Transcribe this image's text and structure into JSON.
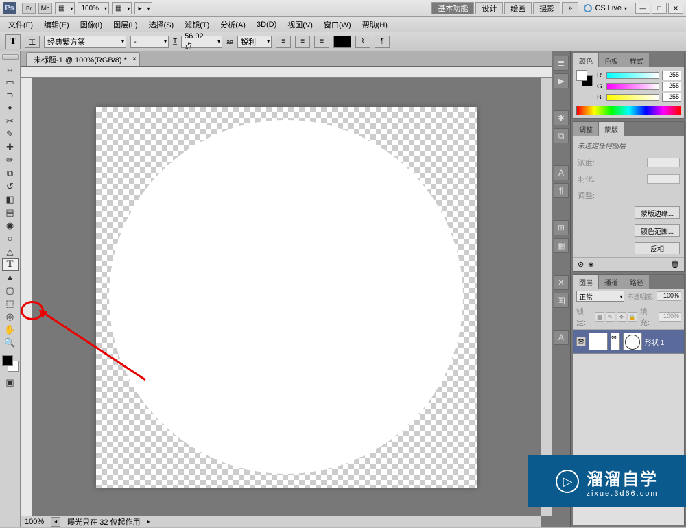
{
  "title_bar": {
    "zoom_dropdown": "100%",
    "workspaces": [
      "基本功能",
      "设计",
      "绘画",
      "摄影"
    ],
    "more_icon": "»",
    "cslive": "CS Live"
  },
  "menu": {
    "items": [
      "文件(F)",
      "编辑(E)",
      "图像(I)",
      "图层(L)",
      "选择(S)",
      "滤镜(T)",
      "分析(A)",
      "3D(D)",
      "视图(V)",
      "窗口(W)",
      "帮助(H)"
    ]
  },
  "options": {
    "orientation": "工",
    "font_family": "经典繁方篆",
    "font_style": "-",
    "font_size": "56.02 点",
    "antialias_label": "aa",
    "antialias": "锐利"
  },
  "doc": {
    "tab_title": "未标题-1 @ 100%(RGB/8) *",
    "zoom": "100%",
    "status": "曝光只在 32 位起作用"
  },
  "color": {
    "tabs": [
      "颜色",
      "色板",
      "样式"
    ],
    "r": "255",
    "g": "255",
    "b": "255"
  },
  "adjust_masks": {
    "tabs": [
      "调整",
      "蒙版"
    ],
    "empty_msg": "未选定任何图层",
    "density_label": "浓度:",
    "feather_label": "羽化:",
    "refine_label": "调整:",
    "btn_mask_edge": "蒙版边缘...",
    "btn_color_range": "颜色范围...",
    "btn_invert": "反相"
  },
  "layers": {
    "tabs": [
      "图层",
      "通道",
      "路径"
    ],
    "blend_mode": "正常",
    "opacity_label": "不透明度:",
    "opacity_val": "100%",
    "lock_label": "锁定:",
    "fill_label": "填充:",
    "fill_val": "100%",
    "layer_name": "形状 1"
  },
  "watermark": {
    "main": "溜溜自学",
    "sub": "zixue.3d66.com"
  }
}
